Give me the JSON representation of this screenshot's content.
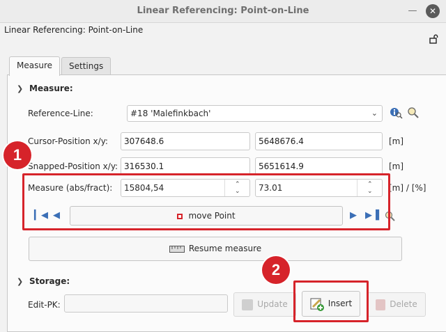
{
  "window": {
    "title": "Linear Referencing: Point-on-Line"
  },
  "panel": {
    "title": "Linear Referencing: Point-on-Line"
  },
  "tabs": [
    {
      "label": "Measure"
    },
    {
      "label": "Settings"
    }
  ],
  "measure_section": {
    "header": "Measure:",
    "reference_line": {
      "label": "Reference-Line:",
      "value": "#18 'Malefinkbach'"
    },
    "cursor_position": {
      "label": "Cursor-Position x/y:",
      "x": "307648.6",
      "y": "5648676.4",
      "unit": "[m]"
    },
    "snapped_position": {
      "label": "Snapped-Position x/y:",
      "x": "316530.1",
      "y": "5651614.9",
      "unit": "[m]"
    },
    "measure": {
      "label": "Measure (abs/fract):",
      "abs": "15804,54",
      "fract": "73.01",
      "unit": "[m] / [%]"
    },
    "move_point_label": "move Point",
    "resume_measure_label": "Resume measure"
  },
  "storage_section": {
    "header": "Storage:",
    "edit_pk_label": "Edit-PK:",
    "edit_pk_value": "",
    "update_label": "Update",
    "insert_label": "Insert",
    "delete_label": "Delete"
  },
  "annotations": {
    "badge1": "1",
    "badge2": "2"
  },
  "colors": {
    "highlight": "#d6232a",
    "nav_blue": "#3b6fb6"
  }
}
